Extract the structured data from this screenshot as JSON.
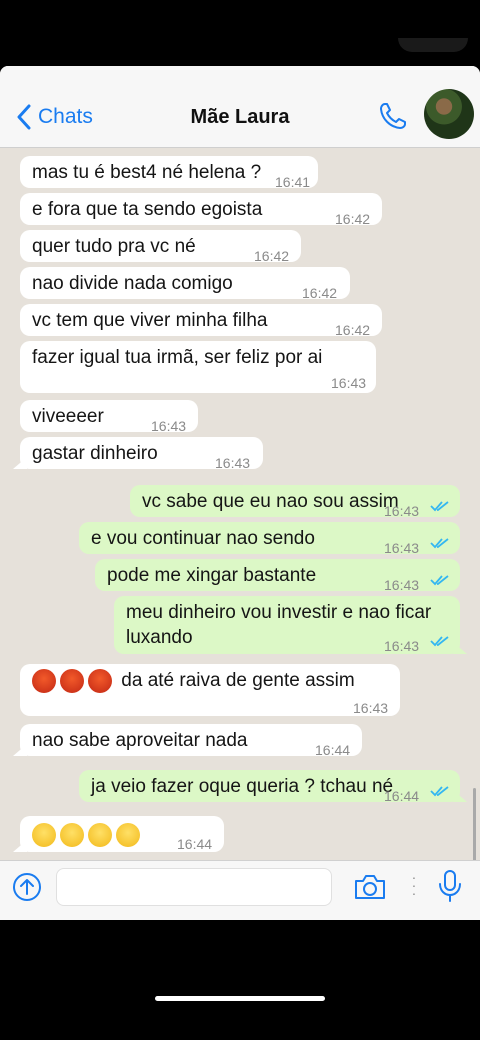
{
  "header": {
    "back_label": "Chats",
    "contact_name": "Mãe Laura"
  },
  "messages": [
    {
      "text": "mas tu é best4 né helena ?",
      "time": "16:41",
      "direction": "in"
    },
    {
      "text": "e fora que ta sendo egoista",
      "time": "16:42",
      "direction": "in"
    },
    {
      "text": "quer tudo pra vc né",
      "time": "16:42",
      "direction": "in"
    },
    {
      "text": "nao divide nada comigo",
      "time": "16:42",
      "direction": "in"
    },
    {
      "text": "vc tem que viver minha filha",
      "time": "16:42",
      "direction": "in"
    },
    {
      "text": "fazer igual tua irmã, ser feliz por ai",
      "time": "16:43",
      "direction": "in"
    },
    {
      "text": "viveeeer",
      "time": "16:43",
      "direction": "in"
    },
    {
      "text": "gastar dinheiro",
      "time": "16:43",
      "direction": "in"
    },
    {
      "text": "vc sabe que eu nao sou assim",
      "time": "16:43",
      "direction": "out"
    },
    {
      "text": "e vou continuar nao sendo",
      "time": "16:43",
      "direction": "out"
    },
    {
      "text": "pode me xingar bastante",
      "time": "16:43",
      "direction": "out"
    },
    {
      "text": "meu dinheiro vou investir e nao ficar luxando",
      "time": "16:43",
      "direction": "out"
    },
    {
      "text": "da até raiva de gente assim",
      "time": "16:43",
      "direction": "in",
      "emoji": "angry-face x3"
    },
    {
      "text": "nao sabe aproveitar nada",
      "time": "16:44",
      "direction": "in"
    },
    {
      "text": "ja veio fazer oque queria ? tchau né",
      "time": "16:44",
      "direction": "out"
    },
    {
      "text": "",
      "time": "16:44",
      "direction": "in",
      "emoji": "rolling-eyes-face x4"
    }
  ],
  "colors": {
    "accent": "#1a7cf0",
    "incoming_bubble": "#ffffff",
    "outgoing_bubble": "#dcf8c6",
    "chat_background": "#e6e1da",
    "read_ticks": "#34b7f1"
  },
  "icons": {
    "back": "chevron-left-icon",
    "call": "phone-icon",
    "attach": "arrow-up-circle-icon",
    "camera": "camera-icon",
    "mic": "microphone-icon"
  }
}
